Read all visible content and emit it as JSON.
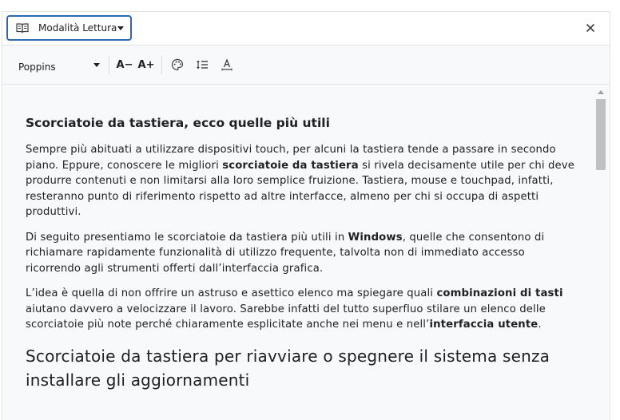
{
  "header": {
    "mode_label": "Modalità Lettura",
    "mode_icon": "book-icon",
    "close_icon": "close-icon"
  },
  "toolbar": {
    "font_name": "Poppins",
    "decrease_label": "A−",
    "increase_label": "A+",
    "icons": [
      "palette-icon",
      "line-spacing-icon",
      "letter-spacing-icon"
    ]
  },
  "article": {
    "h2": "Scorciatoie da tastiera, ecco quelle più utili",
    "p1": [
      "Sempre più abituati a utilizzare dispositivi touch, per alcuni la tastiera tende a passare in secondo piano. Eppure, conoscere le migliori ",
      "scorciatoie da tastiera",
      " si rivela decisamente utile per chi deve produrre contenuti e non limitarsi alla loro semplice fruizione. Tastiera, mouse e touchpad, infatti, resteranno punto di riferimento rispetto ad altre interfacce, almeno per chi si occupa di aspetti produttivi."
    ],
    "p2": [
      "Di seguito presentiamo le scorciatoie da tastiera più utili in ",
      "Windows",
      ", quelle che consentono di richiamare rapidamente funzionalità di utilizzo frequente, talvolta non di immediato accesso ricorrendo agli strumenti offerti dall’interfaccia grafica."
    ],
    "p3": [
      "L’idea è quella di non offrire un astruso e asettico elenco ma spiegare quali ",
      "combinazioni di tasti",
      " aiutano davvero a velocizzare il lavoro. Sarebbe infatti del tutto superfluo stilare un elenco delle scorciatoie più note perché chiaramente esplicitate anche nei menu e nell’",
      "interfaccia utente",
      "."
    ],
    "h1": "Scorciatoie da tastiera per riavviare o spegnere il sistema senza installare gli aggiornamenti"
  },
  "colors": {
    "accent": "#2e67b6",
    "panel_bg": "#f8f9fa",
    "text": "#202124"
  }
}
